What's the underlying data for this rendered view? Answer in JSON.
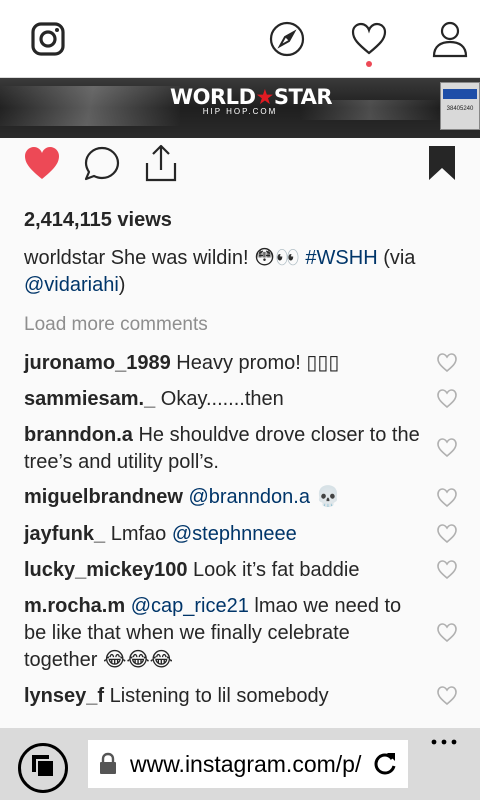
{
  "topbar": {
    "logo_icon": "instagram-icon",
    "explore_icon": "compass-icon",
    "activity_icon": "heart-outline-icon",
    "profile_icon": "person-icon",
    "notification_color": "#ed4956"
  },
  "media": {
    "watermark_main": "WORLD",
    "watermark_star": "★",
    "watermark_main2": "STAR",
    "watermark_sub": "HIP HOP.COM",
    "plate_text": "38405240"
  },
  "actions": {
    "like_icon": "heart-filled-icon",
    "comment_icon": "comment-bubble-icon",
    "share_icon": "share-icon",
    "save_icon": "bookmark-filled-icon",
    "like_color": "#ed4956"
  },
  "post": {
    "views": "2,414,115 views",
    "caption_user": "worldstar",
    "caption_text": " She was wildin! 😳👀 ",
    "caption_tag": "#WSHH",
    "caption_via": " (via",
    "caption_mention": "@vidariahi",
    "caption_close": ")",
    "load_more": "Load more comments"
  },
  "comments": [
    {
      "user": "juronamo_1989",
      "text": " Heavy promo! ▯▯▯"
    },
    {
      "user": "sammiesam._",
      "text": " Okay.......then"
    },
    {
      "user": "branndon.a",
      "text": " He shouldve drove closer to the tree’s and utility poll’s."
    },
    {
      "user": "miguelbrandnew",
      "mention": " @branndon.a",
      "text": " 💀"
    },
    {
      "user": "jayfunk_",
      "text": " Lmfao ",
      "mention": "@stephnneee"
    },
    {
      "user": "lucky_mickey100",
      "text": " Look it’s fat baddie"
    },
    {
      "user": "m.rocha.m",
      "mention": " @cap_rice21",
      "text": " lmao we need to be like that when we finally celebrate together 😂😂😂"
    },
    {
      "user": "lynsey_f",
      "text": " Listening to lil somebody"
    }
  ],
  "browser": {
    "tabs_icon": "tabs-icon",
    "lock_icon": "lock-icon",
    "url": "www.instagram.com/p/",
    "reload_icon": "reload-icon",
    "more_icon": "more-dots-icon"
  }
}
